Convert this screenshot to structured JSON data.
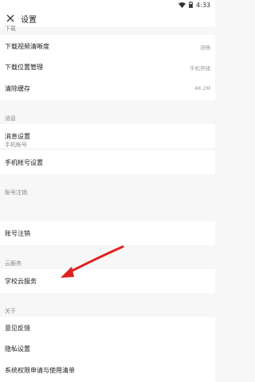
{
  "status_bar": {
    "time": "4:33"
  },
  "app_bar": {
    "title": "设置"
  },
  "sections": [
    {
      "label": "下载"
    },
    {
      "label": "消息"
    },
    {
      "label": "手机帐号"
    },
    {
      "label": "账号注销"
    },
    {
      "label": "云服务"
    },
    {
      "label": "关于"
    }
  ],
  "rows": {
    "video_quality": {
      "label": "下载视频清晰度",
      "value": "流畅"
    },
    "download_location": {
      "label": "下载位置管理",
      "value": "手机存储"
    },
    "clear_cache": {
      "label": "清除缓存",
      "value": "48.2M"
    },
    "message_settings": {
      "label": "消息设置"
    },
    "phone_account_settings": {
      "label": "手机帐号设置"
    },
    "account_cancel": {
      "label": "账号注销"
    },
    "school_cloud": {
      "label": "学校云服务"
    },
    "feedback": {
      "label": "意见反馈"
    },
    "privacy": {
      "label": "隐私设置"
    },
    "permissions": {
      "label": "系统权限申请与使用清单"
    }
  },
  "colors": {
    "annotation_arrow": "#e02020"
  }
}
